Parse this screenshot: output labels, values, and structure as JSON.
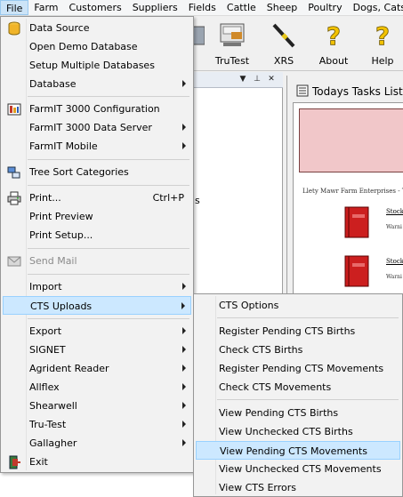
{
  "menubar": {
    "items": [
      "File",
      "Farm",
      "Customers",
      "Suppliers",
      "Fields",
      "Cattle",
      "Sheep",
      "Poultry",
      "Dogs, Cats"
    ]
  },
  "toolbar": {
    "buttons": [
      {
        "label": "le",
        "icon": "scale-icon"
      },
      {
        "label": "TruTest",
        "icon": "trutest-icon"
      },
      {
        "label": "XRS",
        "icon": "xrs-wand-icon"
      },
      {
        "label": "About",
        "icon": "question-icon"
      },
      {
        "label": "Help",
        "icon": "question-icon"
      }
    ]
  },
  "left_pane": {
    "stray_text": "ls"
  },
  "right_pane": {
    "title": "Todays Tasks List",
    "farm_text": "Llety Mawr Farm Enterprises - Tala",
    "entries": [
      {
        "stock": "Stock",
        "warn": "Warni"
      },
      {
        "stock": "Stock",
        "warn": "Warni"
      }
    ]
  },
  "file_menu": {
    "items": [
      {
        "label": "Data Source",
        "icon": "database-icon",
        "arrow": false
      },
      {
        "label": "Open Demo Database",
        "arrow": false
      },
      {
        "label": "Setup Multiple Databases",
        "arrow": false
      },
      {
        "label": "Database",
        "arrow": true
      },
      {
        "label": "FarmIT 3000 Configuration",
        "icon": "config-icon",
        "arrow": false
      },
      {
        "label": "FarmIT 3000 Data Server",
        "arrow": true
      },
      {
        "label": "FarmIT Mobile",
        "arrow": true
      },
      {
        "label": "Tree Sort Categories",
        "icon": "tree-icon",
        "arrow": false
      },
      {
        "label": "Print...",
        "shortcut": "Ctrl+P",
        "icon": "printer-icon",
        "arrow": false
      },
      {
        "label": "Print Preview",
        "arrow": false
      },
      {
        "label": "Print Setup...",
        "arrow": false
      },
      {
        "label": "Send Mail",
        "icon": "mail-icon",
        "disabled": true
      },
      {
        "label": "Import",
        "arrow": true
      },
      {
        "label": "CTS Uploads",
        "arrow": true,
        "highlighted": true
      },
      {
        "label": "Export",
        "arrow": true
      },
      {
        "label": "SIGNET",
        "arrow": true
      },
      {
        "label": "Agrident Reader",
        "arrow": true
      },
      {
        "label": "Allflex",
        "arrow": true
      },
      {
        "label": "Shearwell",
        "arrow": true
      },
      {
        "label": "Tru-Test",
        "arrow": true
      },
      {
        "label": "Gallagher",
        "arrow": true
      },
      {
        "label": "Exit",
        "icon": "exit-icon",
        "arrow": false
      }
    ]
  },
  "cts_submenu": {
    "items": [
      {
        "label": "CTS Options"
      },
      {
        "label": "Register Pending CTS Births"
      },
      {
        "label": "Check CTS Births"
      },
      {
        "label": "Register Pending CTS Movements"
      },
      {
        "label": "Check CTS Movements"
      },
      {
        "label": "View Pending CTS Births"
      },
      {
        "label": "View Unchecked CTS Births"
      },
      {
        "label": "View Pending CTS Movements",
        "highlighted": true
      },
      {
        "label": "View Unchecked CTS Movements"
      },
      {
        "label": "View CTS Errors"
      }
    ]
  },
  "colors": {
    "highlight": "#cce8ff",
    "menu_bg": "#f2f2f2",
    "pink_box": "#f1c7c9",
    "book_red": "#cc1f1f"
  }
}
